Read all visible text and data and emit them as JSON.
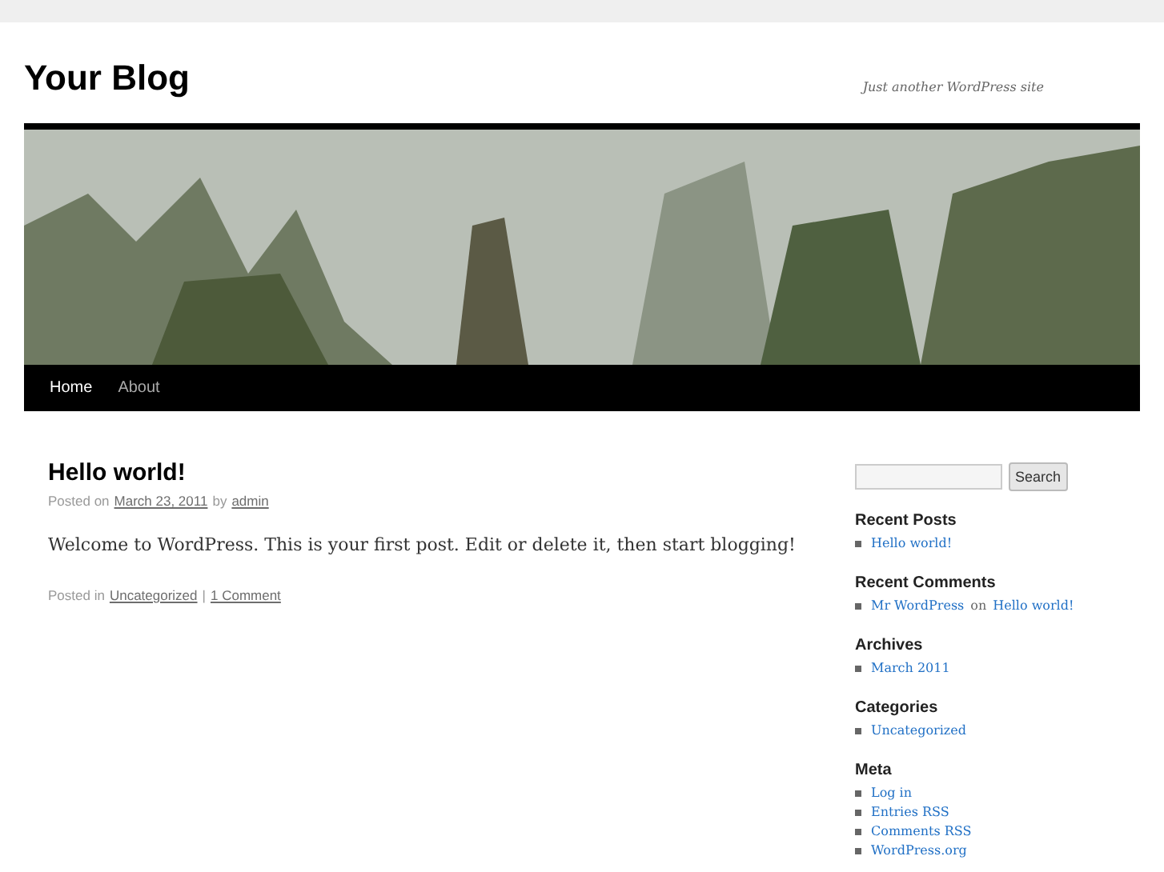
{
  "site": {
    "title": "Your Blog",
    "tagline": "Just another WordPress site"
  },
  "nav": [
    {
      "label": "Home",
      "selected": true
    },
    {
      "label": "About",
      "selected": false
    }
  ],
  "post": {
    "title": "Hello world!",
    "meta": [
      {
        "text": "Posted on",
        "link": false
      },
      {
        "text": "March 23, 2011",
        "link": true
      },
      {
        "text": "by",
        "link": false
      },
      {
        "text": "admin",
        "link": true
      }
    ],
    "body": "Welcome to WordPress. This is your first post. Edit or delete it, then start blogging!",
    "footer": [
      {
        "text": "Posted in",
        "link": false
      },
      {
        "text": "Uncategorized",
        "link": true
      },
      {
        "text": "|",
        "link": false
      },
      {
        "text": "1 Comment",
        "link": true
      }
    ]
  },
  "search": {
    "button": "Search"
  },
  "widgets": [
    {
      "title": "Recent Posts",
      "items": [
        [
          {
            "text": "Hello world!",
            "link": true
          }
        ]
      ]
    },
    {
      "title": "Recent Comments",
      "items": [
        [
          {
            "text": "Mr WordPress",
            "link": true
          },
          {
            "text": "on",
            "link": false
          },
          {
            "text": "Hello world!",
            "link": true
          }
        ]
      ]
    },
    {
      "title": "Archives",
      "items": [
        [
          {
            "text": "March 2011",
            "link": true
          }
        ]
      ]
    },
    {
      "title": "Categories",
      "items": [
        [
          {
            "text": "Uncategorized",
            "link": true
          }
        ]
      ]
    },
    {
      "title": "Meta",
      "items": [
        [
          {
            "text": "Log in",
            "link": true
          }
        ],
        [
          {
            "text": "Entries RSS",
            "link": true
          }
        ],
        [
          {
            "text": "Comments RSS",
            "link": true
          }
        ],
        [
          {
            "text": "WordPress.org",
            "link": true
          }
        ]
      ]
    }
  ]
}
